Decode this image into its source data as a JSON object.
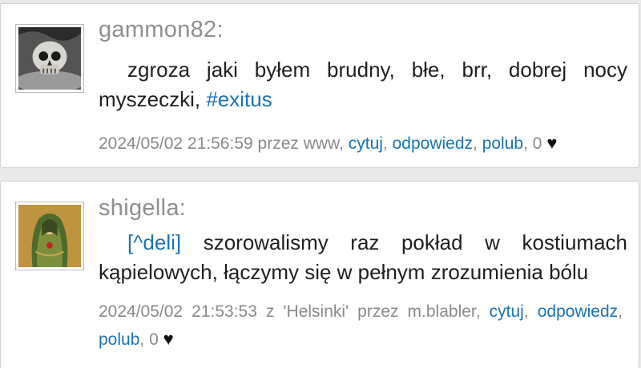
{
  "posts": [
    {
      "username": "gammon82:",
      "message_text": "zgroza jaki byłem brudny, błe, brr, dobrej nocy myszeczki, ",
      "hashtag": "#exitus",
      "timestamp": "2024/05/02 21:56:59",
      "via": "przez www,",
      "actions": {
        "quote": "cytuj",
        "reply": "odpowiedz",
        "like": "polub"
      },
      "likes": "0"
    },
    {
      "username": "shigella:",
      "mention": "[^deli]",
      "message_text": "szorowalismy raz pokład w kostiumach kąpielowych, łączymy się w pełnym zrozumienia bólu",
      "timestamp": "2024/05/02 21:53:53",
      "location": "z 'Helsinki'",
      "via": "przez m.blabler,",
      "actions": {
        "quote": "cytuj",
        "reply": "odpowiedz",
        "like": "polub"
      },
      "likes": "0"
    }
  ],
  "icons": {
    "heart": "heart-icon"
  },
  "colors": {
    "link": "#1a73b8",
    "username": "#8f8f8f",
    "meta": "#8a8a8a"
  }
}
